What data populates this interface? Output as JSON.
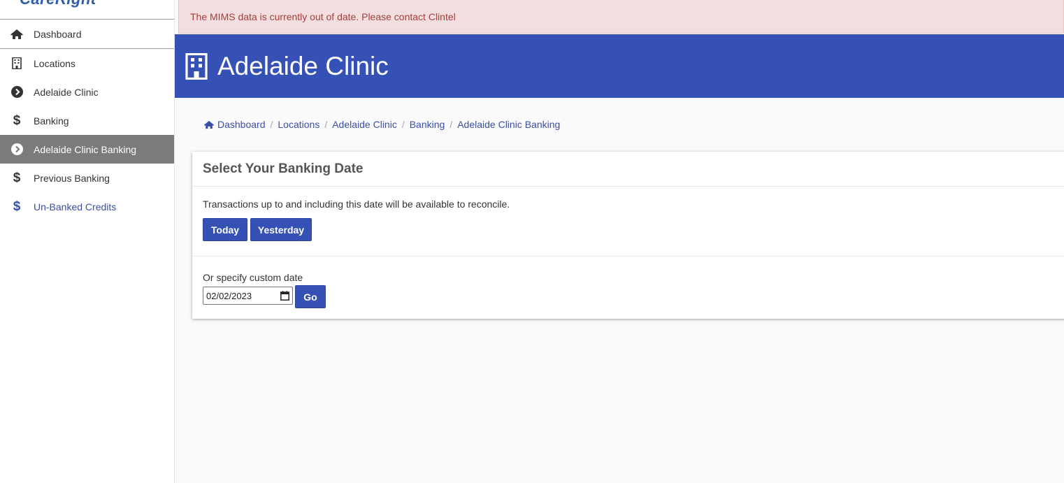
{
  "app": {
    "logo_text": "CareRight"
  },
  "sidebar": {
    "items": [
      {
        "label": "Dashboard",
        "icon": "home-icon"
      },
      {
        "label": "Locations",
        "icon": "building-icon"
      },
      {
        "label": "Adelaide Clinic",
        "icon": "chevron-circle-right-icon"
      },
      {
        "label": "Banking",
        "icon": "dollar-icon"
      },
      {
        "label": "Adelaide Clinic Banking",
        "icon": "chevron-circle-right-icon",
        "active": true
      },
      {
        "label": "Previous Banking",
        "icon": "dollar-icon"
      },
      {
        "label": "Un-Banked Credits",
        "icon": "dollar-icon"
      }
    ]
  },
  "alert": {
    "text": "The MIMS data is currently out of date. Please contact Clintel"
  },
  "header": {
    "title": "Adelaide Clinic",
    "icon": "building-icon"
  },
  "breadcrumb": {
    "items": [
      "Dashboard",
      "Locations",
      "Adelaide Clinic",
      "Banking",
      "Adelaide Clinic Banking"
    ],
    "separator": "/"
  },
  "card": {
    "title": "Select Your Banking Date",
    "description": "Transactions up to and including this date will be available to reconcile.",
    "today_label": "Today",
    "yesterday_label": "Yesterday",
    "custom_label": "Or specify custom date",
    "date_value": "02/02/2023",
    "go_label": "Go"
  },
  "colors": {
    "primary": "#3651b5",
    "alert_bg": "#f2dede",
    "alert_text": "#a33f3f",
    "active_nav_bg": "#7b7b7b",
    "link": "#3a4fa7"
  }
}
